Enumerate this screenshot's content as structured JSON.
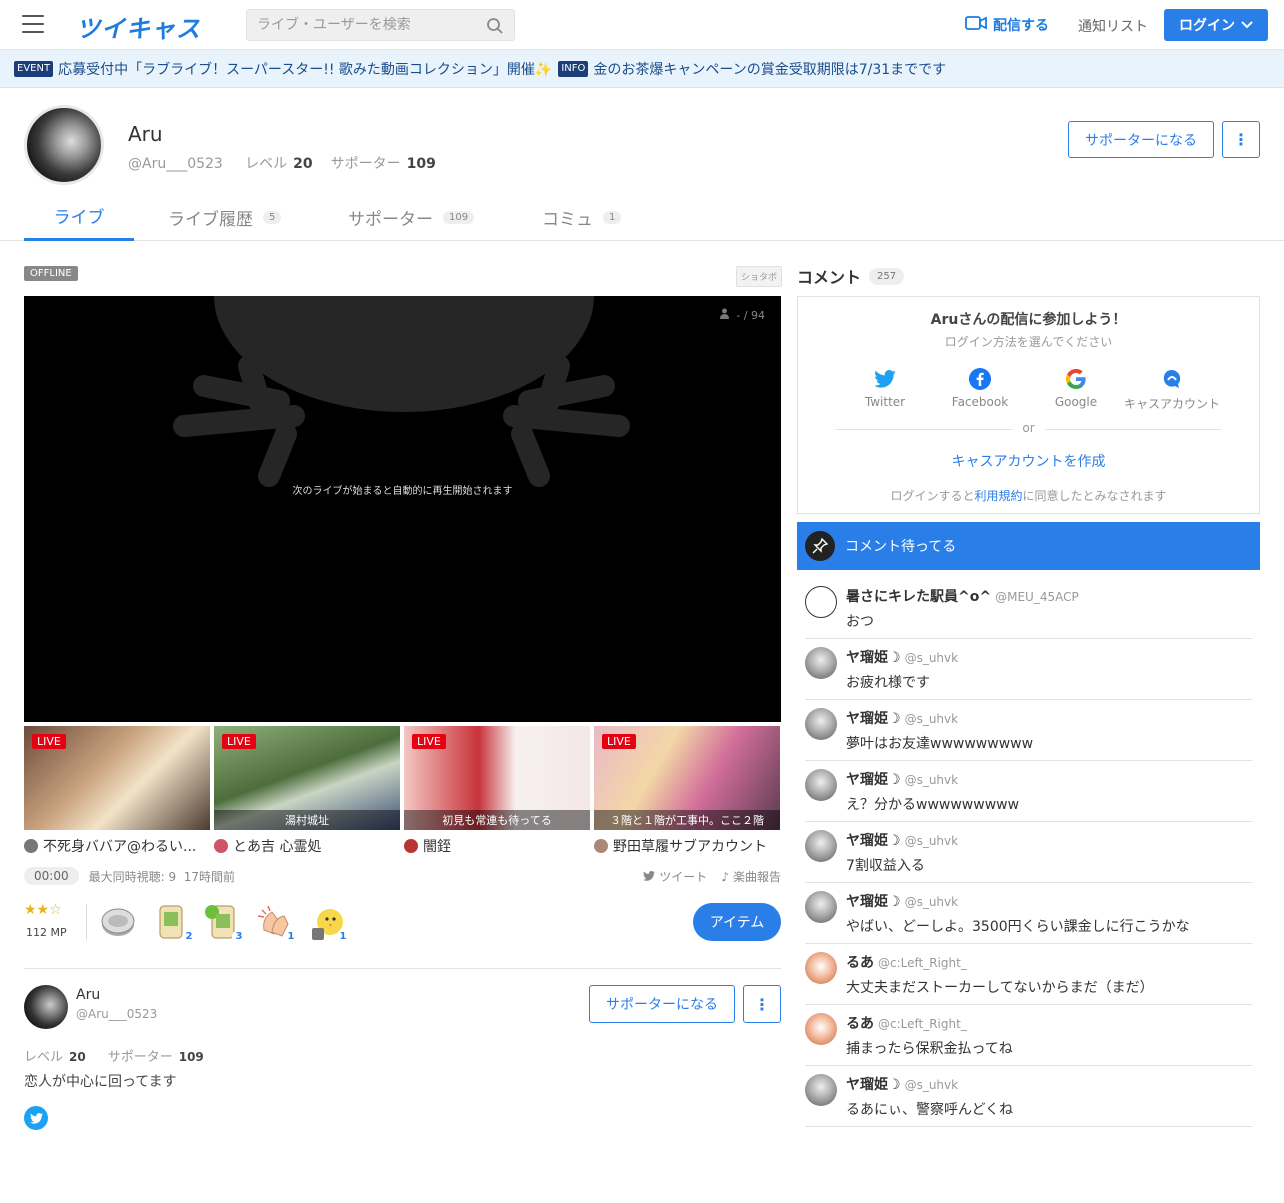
{
  "header": {
    "logo": "ツイキャス",
    "search_placeholder": "ライブ・ユーザーを検索",
    "broadcast_label": "配信する",
    "notify_label": "通知リスト",
    "login_label": "ログイン"
  },
  "banner": {
    "event_tag": "EVENT",
    "event_text": "応募受付中「ラブライブ！スーパースター!! 歌みた動画コレクション」開催✨",
    "info_tag": "INFO",
    "info_text": "金のお茶爆キャンペーンの賞金受取期限は7/31までです"
  },
  "profile": {
    "name": "Aru",
    "id": "@Aru___0523",
    "level_label": "レベル",
    "level": "20",
    "supporter_label": "サポーター",
    "supporters": "109",
    "support_button": "サポーターになる"
  },
  "tabs": [
    {
      "label": "ライブ",
      "count": ""
    },
    {
      "label": "ライブ履歴",
      "count": "5"
    },
    {
      "label": "サポーター",
      "count": "109"
    },
    {
      "label": "コミュ",
      "count": "1"
    }
  ],
  "player": {
    "status": "OFFLINE",
    "shotabo": "ショタボ",
    "viewers": "- / 94",
    "message": "次のライブが始まると自動的に再生開始されます"
  },
  "thumbs": [
    {
      "live": "LIVE",
      "caption": "",
      "name": "不死身ババア@わるい..."
    },
    {
      "live": "LIVE",
      "caption": "湯村城址",
      "name": "とあ吉 心霊処"
    },
    {
      "live": "LIVE",
      "caption": "初見も常連も待ってる",
      "name": "闇銍"
    },
    {
      "live": "LIVE",
      "caption": "３階と１階が工事中。ここ２階",
      "name": "野田草履サブアカウント"
    }
  ],
  "stream_meta": {
    "time": "00:00",
    "max_viewers": "最大同時視聴: 9",
    "ago": "17時間前",
    "tweet": "ツイート",
    "song_report": "楽曲報告"
  },
  "items_row": {
    "mp": "112 MP",
    "gifts": [
      "",
      "2",
      "3",
      "1",
      "1"
    ],
    "item_button": "アイテム"
  },
  "about": {
    "name": "Aru",
    "id": "@Aru___0523",
    "level_label": "レベル",
    "level": "20",
    "supporter_label": "サポーター",
    "supporters": "109",
    "support_button": "サポーターになる",
    "bio": "恋人が中心に回ってます"
  },
  "comments_panel": {
    "title": "コメント",
    "count": "257",
    "join_title": "Aruさんの配信に参加しよう！",
    "join_sub": "ログイン方法を選んでください",
    "sns": [
      "Twitter",
      "Facebook",
      "Google",
      "キャスアカウント"
    ],
    "or": "or",
    "create": "キャスアカウントを作成",
    "terms_pre": "ログインすると",
    "terms_link": "利用規約",
    "terms_post": "に同意したとみなされます",
    "pinned": "コメント待ってる"
  },
  "comments": [
    {
      "name": "暑さにキレた駅員^o^",
      "id": "@MEU_45ACP",
      "text": "おつ",
      "avatar": "mono"
    },
    {
      "name": "ヤ瑠姫☽",
      "id": "@s_uhvk",
      "text": "お疲れ様です",
      "avatar": "gray"
    },
    {
      "name": "ヤ瑠姫☽",
      "id": "@s_uhvk",
      "text": "夢叶はお友達wwwwwwwww",
      "avatar": "gray"
    },
    {
      "name": "ヤ瑠姫☽",
      "id": "@s_uhvk",
      "text": "え？分かるwwwwwwwww",
      "avatar": "gray"
    },
    {
      "name": "ヤ瑠姫☽",
      "id": "@s_uhvk",
      "text": "7割収益入る",
      "avatar": "gray"
    },
    {
      "name": "ヤ瑠姫☽",
      "id": "@s_uhvk",
      "text": "やばい、どーしよ。3500円くらい課金しに行こうかな",
      "avatar": "gray"
    },
    {
      "name": "るあ",
      "id": "@c:Left_Right_",
      "text": "大丈夫まだストーカーしてないからまだ（まだ）",
      "avatar": "peach"
    },
    {
      "name": "るあ",
      "id": "@c:Left_Right_",
      "text": "捕まったら保釈金払ってね",
      "avatar": "peach"
    },
    {
      "name": "ヤ瑠姫☽",
      "id": "@s_uhvk",
      "text": "るあにぃ、警察呼んどくね",
      "avatar": "gray"
    }
  ],
  "colors": {
    "accent": "#2a7ee8",
    "live": "#e60012",
    "banner_bg": "#e9f3fc"
  }
}
